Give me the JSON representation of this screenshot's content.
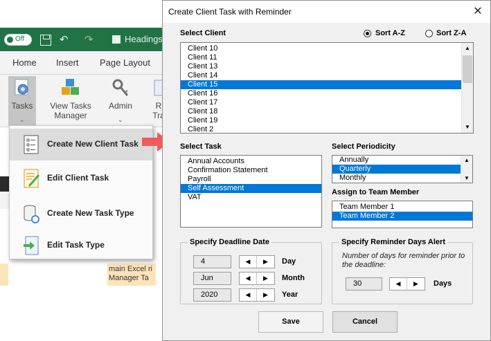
{
  "excel": {
    "toggle_label": "Off",
    "headings_label": "Headings",
    "menu": [
      "Home",
      "Insert",
      "Page Layout"
    ],
    "ribbon": {
      "tasks_label": "Tasks",
      "view_tasks_label_1": "View Tasks",
      "view_tasks_label_2": "Manager",
      "admin_label": "Admin",
      "partial_label_1": "R",
      "partial_label_2": "Tra"
    },
    "sheet_text_1": "main Excel ri",
    "sheet_text_2": "Manager Ta",
    "dropdown": [
      {
        "label": "Create New Client Task",
        "icon": "checklist-icon"
      },
      {
        "label": "Edit Client Task",
        "icon": "edit-document-icon"
      },
      {
        "label": "Create New Task Type",
        "icon": "database-gear-icon"
      },
      {
        "label": "Edit Task Type",
        "icon": "document-arrow-icon"
      }
    ],
    "colors": {
      "accent": "#217346",
      "arrow": "#f25a5a"
    }
  },
  "dialog": {
    "title": "Create Client Task with Reminder",
    "select_client_label": "Select Client",
    "sort_az": "Sort A-Z",
    "sort_za": "Sort Z-A",
    "sort_selected": "Sort A-Z",
    "clients": [
      "Client 10",
      "Client 11",
      "Client 13",
      "Client 14",
      "Client 15",
      "Client 16",
      "Client 17",
      "Client 18",
      "Client 19",
      "Client 2"
    ],
    "client_selected": "Client 15",
    "select_task_label": "Select Task",
    "tasks": [
      "Annual Accounts",
      "Confirmation Statement",
      "Payroll",
      "Self Assessment",
      "VAT"
    ],
    "task_selected": "Self Assessment",
    "select_periodicity_label": "Select Periodicity",
    "periodicities": [
      "Annually",
      "Quarterly",
      "Monthly"
    ],
    "periodicity_selected": "Quarterly",
    "assign_label": "Assign to Team Member",
    "team_members": [
      "Team Member 1",
      "Team Member 2"
    ],
    "team_selected": "Team Member 2",
    "deadline_group_label": "Specify Deadline Date",
    "day_value": "4",
    "month_value": "Jun",
    "year_value": "2020",
    "day_label": "Day",
    "month_label": "Month",
    "year_label": "Year",
    "reminder_group_label": "Specify Reminder Days Alert",
    "reminder_note": "Number of days for reminder prior to the deadline:",
    "reminder_value": "30",
    "days_label": "Days",
    "save_label": "Save",
    "cancel_label": "Cancel",
    "colors": {
      "selection": "#0078d7",
      "dialog_bg": "#f0f0f0"
    }
  }
}
